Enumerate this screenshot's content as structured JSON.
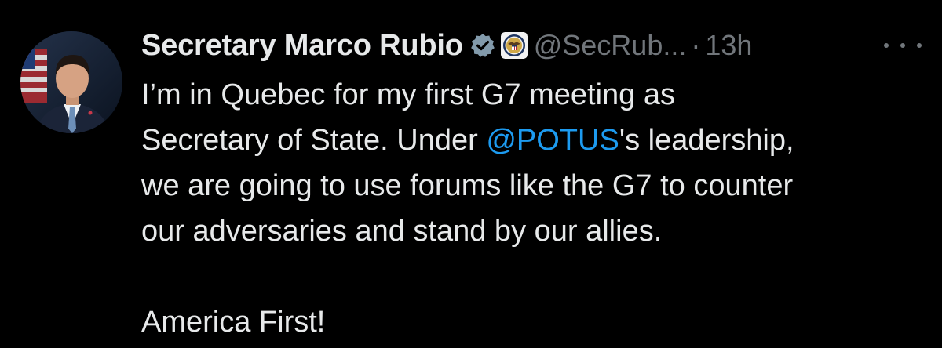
{
  "author": {
    "display_name": "Secretary Marco Rubio",
    "handle": "@SecRub...",
    "separator": "·",
    "time": "13h",
    "verified_icon": "verified-badge-icon",
    "affiliate_icon": "state-department-seal-icon"
  },
  "tweet": {
    "line1": "I’m in Quebec for my first G7 meeting as",
    "line2_pre": "Secretary of State. Under ",
    "mention": "@POTUS",
    "line2_post": "'s leadership,",
    "line3": "we are going to use forums like the G7 to counter",
    "line4": "our adversaries and stand by our allies.",
    "line5": "America First!"
  },
  "colors": {
    "background": "#000000",
    "text": "#e7e9ea",
    "muted": "#71767b",
    "link": "#1d9bf0",
    "verified": "#829aab"
  },
  "icons": {
    "more": "more-options-icon",
    "avatar": "profile-avatar"
  }
}
